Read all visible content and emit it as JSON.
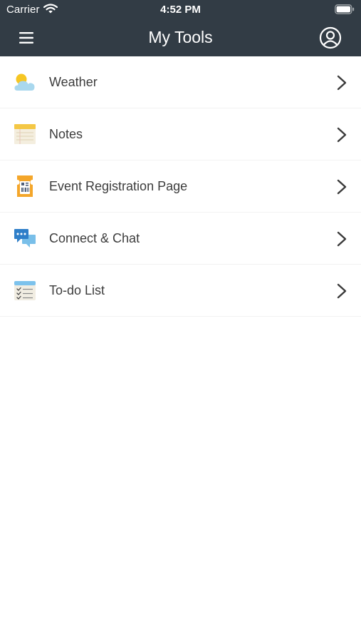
{
  "status_bar": {
    "carrier": "Carrier",
    "time": "4:52 PM"
  },
  "nav": {
    "title": "My Tools",
    "menu_icon": "hamburger-menu-icon",
    "profile_icon": "user-circle-icon"
  },
  "tools": [
    {
      "label": "Weather",
      "icon": "weather-icon"
    },
    {
      "label": "Notes",
      "icon": "notes-icon"
    },
    {
      "label": "Event Registration Page",
      "icon": "ticket-icon"
    },
    {
      "label": "Connect & Chat",
      "icon": "chat-icon"
    },
    {
      "label": "To-do List",
      "icon": "checklist-icon"
    }
  ],
  "colors": {
    "header_bg": "#323c45",
    "header_text": "#ffffff",
    "row_text": "#3c3c3c",
    "divider": "#f2f2f2"
  }
}
